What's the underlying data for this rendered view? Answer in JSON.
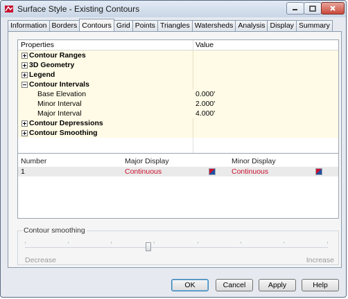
{
  "window": {
    "title": "Surface Style - Existing Contours"
  },
  "tabs": [
    {
      "label": "Information"
    },
    {
      "label": "Borders"
    },
    {
      "label": "Contours",
      "active": true
    },
    {
      "label": "Grid"
    },
    {
      "label": "Points"
    },
    {
      "label": "Triangles"
    },
    {
      "label": "Watersheds"
    },
    {
      "label": "Analysis"
    },
    {
      "label": "Display"
    },
    {
      "label": "Summary"
    }
  ],
  "properties": {
    "header": {
      "property": "Properties",
      "value": "Value"
    },
    "rows": [
      {
        "label": "Contour Ranges",
        "expanded": false,
        "value": ""
      },
      {
        "label": "3D Geometry",
        "expanded": false,
        "value": ""
      },
      {
        "label": "Legend",
        "expanded": false,
        "value": ""
      },
      {
        "label": "Contour Intervals",
        "expanded": true,
        "value": ""
      },
      {
        "label": "Base Elevation",
        "value": "0.000'"
      },
      {
        "label": "Minor Interval",
        "value": "2.000'"
      },
      {
        "label": "Major Interval",
        "value": "4.000'"
      },
      {
        "label": "Contour Depressions",
        "expanded": false,
        "value": ""
      },
      {
        "label": "Contour Smoothing",
        "expanded": false,
        "value": ""
      }
    ]
  },
  "display_list": {
    "headers": {
      "number": "Number",
      "major": "Major Display",
      "minor": "Minor Display"
    },
    "rows": [
      {
        "number": "1",
        "major": "Continuous",
        "minor": "Continuous"
      }
    ]
  },
  "smoothing": {
    "label": "Contour smoothing",
    "min_label": "Decrease",
    "max_label": "Increase",
    "level": 0.42
  },
  "buttons": {
    "ok": "OK",
    "cancel": "Cancel",
    "apply": "Apply",
    "help": "Help"
  },
  "colors": {
    "accent_red": "#c8102e",
    "row_highlight": "#fffbe6"
  }
}
